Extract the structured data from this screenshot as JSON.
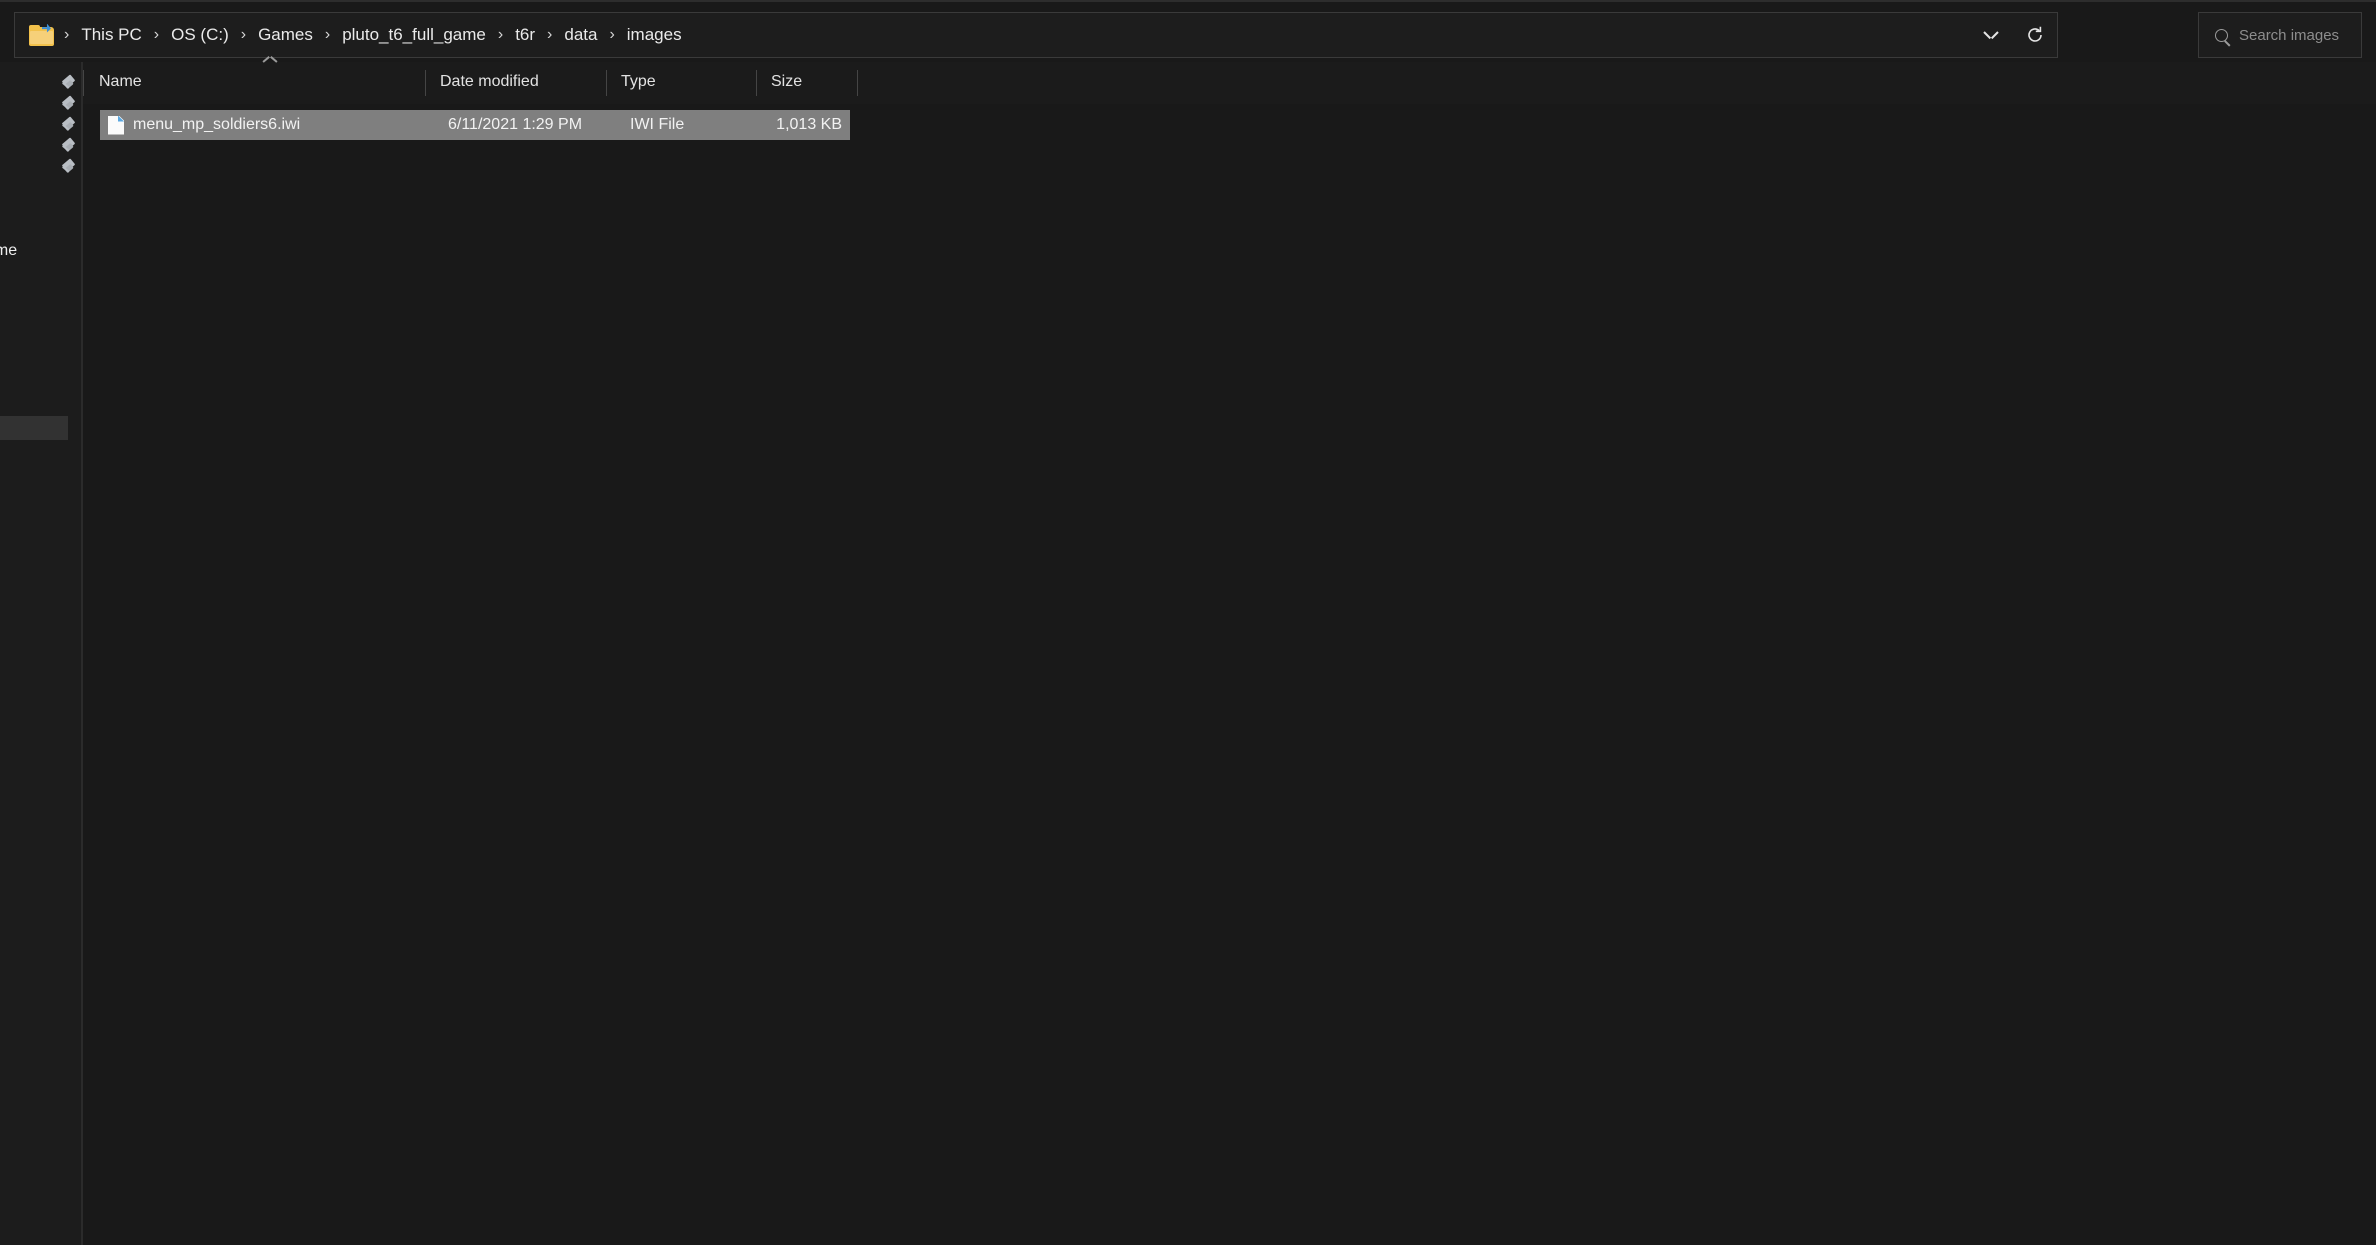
{
  "window": {
    "background": "#191919",
    "accent_folder_color": "#f2c14b",
    "selection_color": "#7f7f7f"
  },
  "address_bar": {
    "folder_icon": "folder-icon",
    "separator": "›",
    "breadcrumbs": [
      {
        "label": "This PC"
      },
      {
        "label": "OS (C:)"
      },
      {
        "label": "Games"
      },
      {
        "label": "pluto_t6_full_game"
      },
      {
        "label": "t6r"
      },
      {
        "label": "data"
      },
      {
        "label": "images"
      }
    ],
    "history_dropdown_icon": "chevron-down-icon",
    "refresh_icon": "refresh-icon"
  },
  "search": {
    "icon": "search-icon",
    "placeholder": "Search images",
    "value": ""
  },
  "sidebar": {
    "pin_icon": "pin-icon",
    "pin_count": 5,
    "clipped_label": "ame",
    "hover_row_color": "#323232"
  },
  "file_list": {
    "columns": [
      {
        "label": "Name",
        "sorted": "ascending",
        "sort_icon": "caret-up-icon"
      },
      {
        "label": "Date modified"
      },
      {
        "label": "Type"
      },
      {
        "label": "Size"
      }
    ],
    "rows": [
      {
        "icon": "file-icon",
        "name": "menu_mp_soldiers6.iwi",
        "date_modified": "6/11/2021 1:29 PM",
        "type": "IWI File",
        "size": "1,013 KB",
        "selected": true
      }
    ]
  }
}
